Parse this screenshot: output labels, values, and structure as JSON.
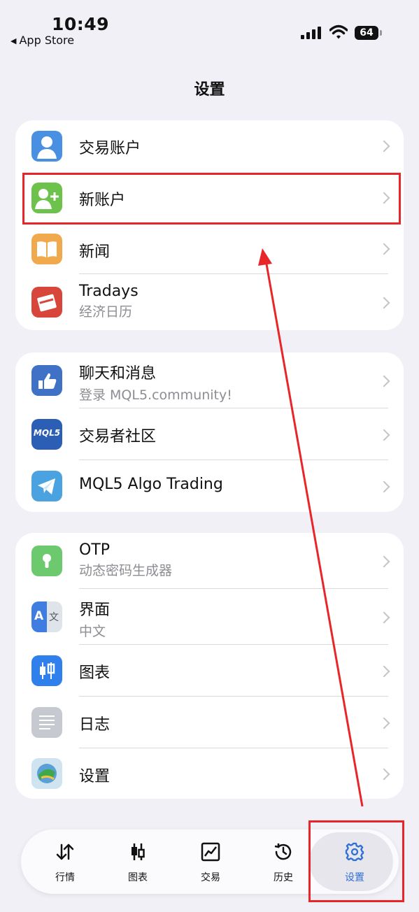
{
  "status_bar": {
    "time": "10:49",
    "back_label": "App Store",
    "battery": "64"
  },
  "header": {
    "title": "设置"
  },
  "groups": [
    {
      "items": [
        {
          "title": "交易账户",
          "subtitle": ""
        },
        {
          "title": "新账户",
          "subtitle": ""
        },
        {
          "title": "新闻",
          "subtitle": ""
        },
        {
          "title": "Tradays",
          "subtitle": "经济日历"
        }
      ]
    },
    {
      "items": [
        {
          "title": "聊天和消息",
          "subtitle": "登录 MQL5.community!"
        },
        {
          "title": "交易者社区",
          "subtitle": ""
        },
        {
          "title": "MQL5 Algo Trading",
          "subtitle": ""
        }
      ]
    },
    {
      "items": [
        {
          "title": "OTP",
          "subtitle": "动态密码生成器"
        },
        {
          "title": "界面",
          "subtitle": "中文"
        },
        {
          "title": "图表",
          "subtitle": ""
        },
        {
          "title": "日志",
          "subtitle": ""
        },
        {
          "title": "设置",
          "subtitle": ""
        }
      ]
    }
  ],
  "icons": {
    "mql5_text": "MQL5",
    "lang_a": "A",
    "lang_zh": "文"
  },
  "tabbar": [
    {
      "label": "行情",
      "icon": "quotes-icon"
    },
    {
      "label": "图表",
      "icon": "chart-icon"
    },
    {
      "label": "交易",
      "icon": "trade-icon"
    },
    {
      "label": "历史",
      "icon": "history-icon"
    },
    {
      "label": "设置",
      "icon": "settings-gear-icon",
      "active": true
    }
  ],
  "colors": {
    "accent": "#2f6fd8",
    "annotation": "#e8262a"
  }
}
